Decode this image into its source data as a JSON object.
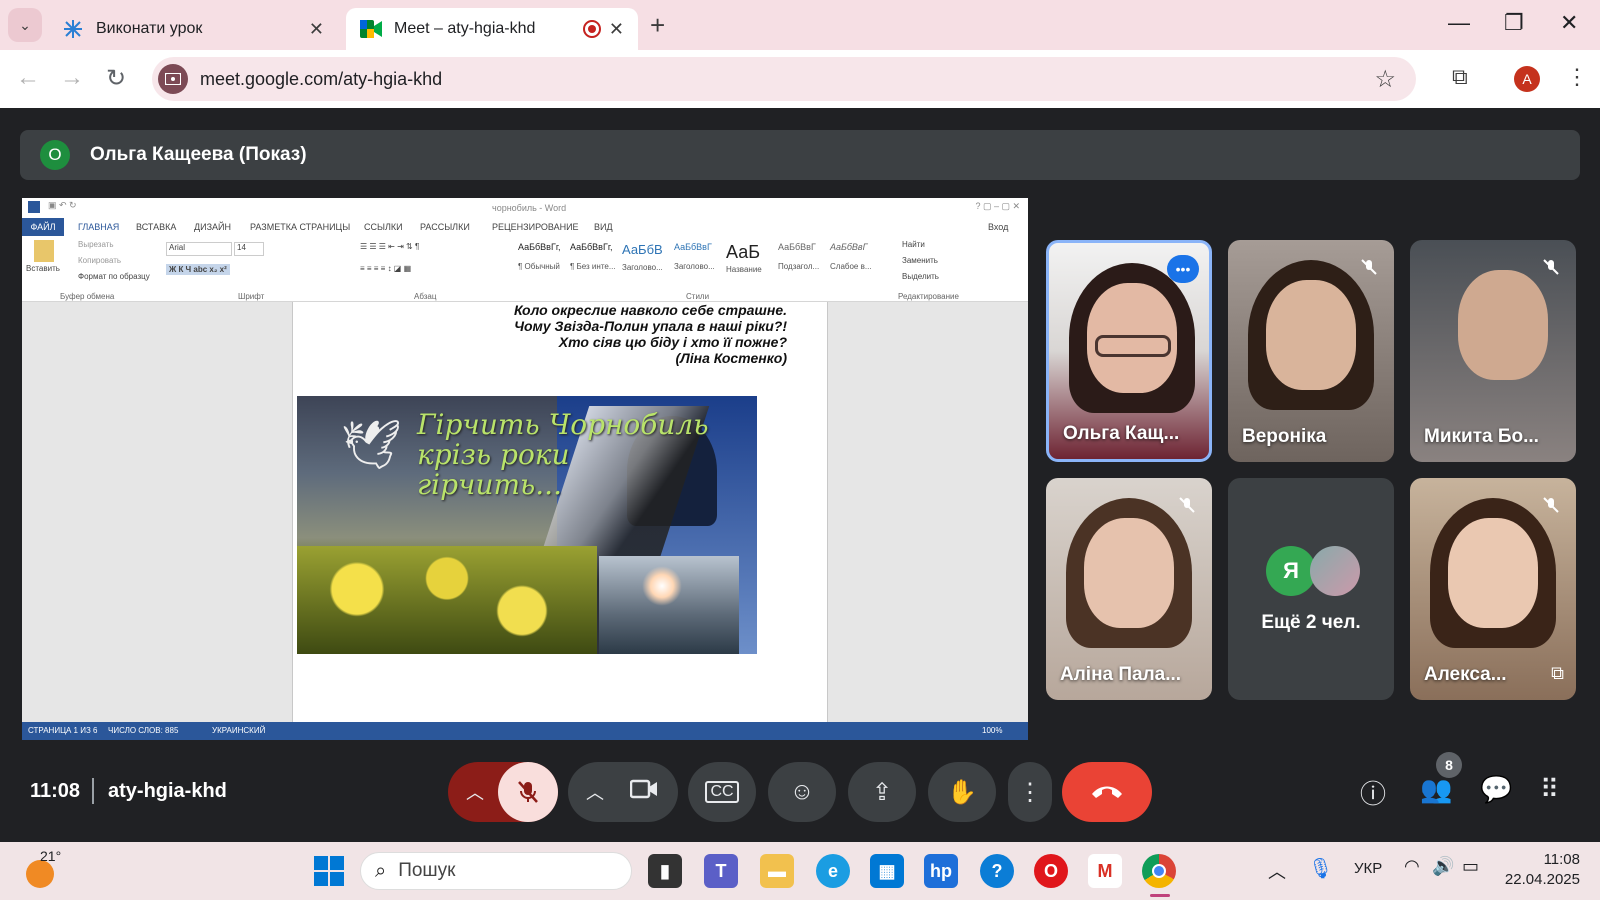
{
  "browser": {
    "tabs": [
      {
        "title": "Виконати урок",
        "close": "✕"
      },
      {
        "title": "Meet – aty-hgia-khd",
        "close": "✕"
      }
    ],
    "new_tab": "+",
    "url": "meet.google.com/aty-hgia-khd",
    "profile_initial": "A"
  },
  "meet": {
    "presenter": {
      "initial": "О",
      "label": "Ольга Кащеева (Показ)"
    },
    "shared_screen": {
      "window_title": "чорнобиль - Word",
      "ribbon_tabs": [
        "ФАЙЛ",
        "ГЛАВНАЯ",
        "ВСТАВКА",
        "ДИЗАЙН",
        "РАЗМЕТКА СТРАНИЦЫ",
        "ССЫЛКИ",
        "РАССЫЛКИ",
        "РЕЦЕНЗИРОВАНИЕ",
        "ВИД"
      ],
      "signin": "Вход",
      "clipboard": {
        "paste": "Вставить",
        "cut": "Вырезать",
        "copy": "Копировать",
        "format": "Формат по образцу",
        "label": "Буфер обмена"
      },
      "font": {
        "name": "Arial",
        "size": "14",
        "label": "Шрифт"
      },
      "paragraph_label": "Абзац",
      "styles": [
        {
          "sample": "АаБбВвГг,",
          "name": "¶ Обычный"
        },
        {
          "sample": "АаБбВвГг,",
          "name": "¶ Без инте..."
        },
        {
          "sample": "АаБбВ",
          "name": "Заголово..."
        },
        {
          "sample": "АаБбВвГ",
          "name": "Заголово..."
        },
        {
          "sample": "АаБ",
          "name": "Название"
        },
        {
          "sample": "АаБбВвГ",
          "name": "Подзагол..."
        },
        {
          "sample": "АаБбВвГ",
          "name": "Слабое в..."
        }
      ],
      "styles_label": "Стили",
      "editing": {
        "find": "Найти",
        "replace": "Заменить",
        "select": "Выделить",
        "label": "Редактирование"
      },
      "poem_lines": [
        "Коло окреслие навколо себе страшне.",
        "Чому Звізда-Полин упала в наші ріки?!",
        "Хто сіяв цю біду і хто її пожне?",
        "(Ліна Костенко)"
      ],
      "poster_lines": [
        "Гірчить Чорнобиль",
        "крізь роки",
        "гірчить..."
      ],
      "status": {
        "page": "СТРАНИЦА 1 ИЗ 6",
        "words": "ЧИСЛО СЛОВ: 885",
        "lang": "УКРАИНСКИЙ",
        "zoom": "100%"
      }
    },
    "participants": [
      {
        "name": "Ольга Кащ..."
      },
      {
        "name": "Вероніка"
      },
      {
        "name": "Микита Бо..."
      },
      {
        "name": "Аліна Пала..."
      },
      {
        "name": "Алекса..."
      }
    ],
    "more": {
      "initial": "Я",
      "label": "Ещё 2 чел."
    },
    "time": "11:08",
    "meeting_code": "aty-hgia-khd",
    "people_count": "8"
  },
  "taskbar": {
    "temperature": "21°",
    "search_placeholder": "Пошук",
    "lang": "УКР",
    "time": "11:08",
    "date": "22.04.2025"
  },
  "colors": {
    "end_call": "#ea4335",
    "mic_off_bg": "#f9dedc",
    "accent_active": "#8ab4f8",
    "meet_bg": "#202124"
  }
}
